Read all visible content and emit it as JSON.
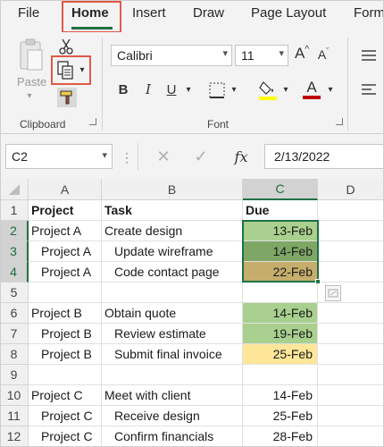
{
  "tabs": [
    {
      "label": "File"
    },
    {
      "label": "Home"
    },
    {
      "label": "Insert"
    },
    {
      "label": "Draw"
    },
    {
      "label": "Page Layout"
    },
    {
      "label": "Form"
    }
  ],
  "ribbon": {
    "paste_label": "Paste",
    "clipboard_label": "Clipboard",
    "font_label": "Font",
    "font_name": "Calibri",
    "font_size": "11",
    "grow_font": "A",
    "shrink_font": "A",
    "bold": "B",
    "italic": "I",
    "underline": "U",
    "font_color_glyph": "A"
  },
  "formula_bar": {
    "name_box": "C2",
    "fx": "fx",
    "value": "2/13/2022"
  },
  "columns": [
    "A",
    "B",
    "C",
    "D"
  ],
  "rows": [
    {
      "num": "1",
      "a": "Project",
      "b": "Task",
      "c": "Due",
      "fill": "",
      "header": true
    },
    {
      "num": "2",
      "a": "Project A",
      "b": "Create design",
      "c": "13-Feb",
      "fill": "#a9d08e"
    },
    {
      "num": "3",
      "a": "Project A",
      "b": "Update wireframe",
      "c": "14-Feb",
      "fill": "#7ea766",
      "indent": true
    },
    {
      "num": "4",
      "a": "Project A",
      "b": "Code contact page",
      "c": "22-Feb",
      "fill": "#c6ad6c",
      "indent": true
    },
    {
      "num": "5",
      "a": "",
      "b": "",
      "c": "",
      "fill": ""
    },
    {
      "num": "6",
      "a": "Project B",
      "b": "Obtain quote",
      "c": "14-Feb",
      "fill": "#a9d08e"
    },
    {
      "num": "7",
      "a": "Project B",
      "b": "Review estimate",
      "c": "19-Feb",
      "fill": "#a9d08e",
      "indent": true
    },
    {
      "num": "8",
      "a": "Project B",
      "b": "Submit final invoice",
      "c": "25-Feb",
      "fill": "#ffe699",
      "indent": true
    },
    {
      "num": "9",
      "a": "",
      "b": "",
      "c": "",
      "fill": ""
    },
    {
      "num": "10",
      "a": "Project C",
      "b": "Meet with client",
      "c": "14-Feb",
      "fill": ""
    },
    {
      "num": "11",
      "a": "Project C",
      "b": "Receive design",
      "c": "25-Feb",
      "fill": "",
      "indent": true
    },
    {
      "num": "12",
      "a": "Project C",
      "b": "Confirm financials",
      "c": "28-Feb",
      "fill": "",
      "indent": true
    }
  ],
  "colors": {
    "accent": "#1e7145",
    "highlight_box": "#e05a47",
    "highlight_fill": "#ffff00",
    "font_color": "#c00000"
  }
}
